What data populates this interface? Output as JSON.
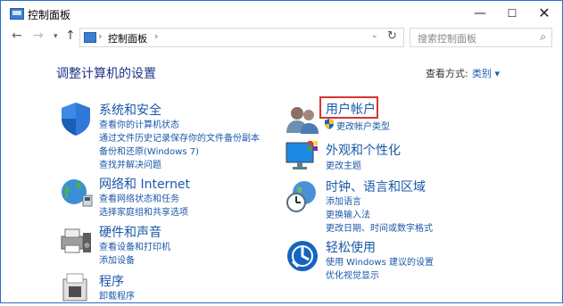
{
  "window": {
    "title": "控制面板",
    "minimize": "—",
    "maximize": "☐",
    "close": "✕"
  },
  "nav": {
    "back": "←",
    "forward": "→",
    "history": "▾",
    "up": "↑",
    "breadcrumb": [
      "控制面板"
    ],
    "separator": "›",
    "address_dropdown": "⌄",
    "refresh": "↻",
    "search_placeholder": "搜索控制面板",
    "search_icon": "⌕"
  },
  "main": {
    "title": "调整计算机的设置",
    "view_by_label": "查看方式:",
    "view_by_value": "类别 ▾"
  },
  "categories": [
    {
      "title": "系统和安全",
      "links": [
        "查看你的计算机状态",
        "通过文件历史记录保存你的文件备份副本",
        "备份和还原(Windows 7)",
        "查找并解决问题"
      ]
    },
    {
      "title": "网络和 Internet",
      "links": [
        "查看网络状态和任务",
        "选择家庭组和共享选项"
      ]
    },
    {
      "title": "硬件和声音",
      "links": [
        "查看设备和打印机",
        "添加设备"
      ]
    },
    {
      "title": "程序",
      "links": [
        "卸载程序"
      ]
    },
    {
      "title": "用户帐户",
      "links": [
        "更改帐户类型"
      ]
    },
    {
      "title": "外观和个性化",
      "links": [
        "更改主题"
      ]
    },
    {
      "title": "时钟、语言和区域",
      "links": [
        "添加语言",
        "更换输入法",
        "更改日期、时间或数字格式"
      ]
    },
    {
      "title": "轻松使用",
      "links": [
        "使用 Windows 建议的设置",
        "优化视觉显示"
      ]
    }
  ],
  "colors": {
    "accent": "#1a58a8",
    "title": "#1e3287",
    "highlight": "#d9342b"
  }
}
